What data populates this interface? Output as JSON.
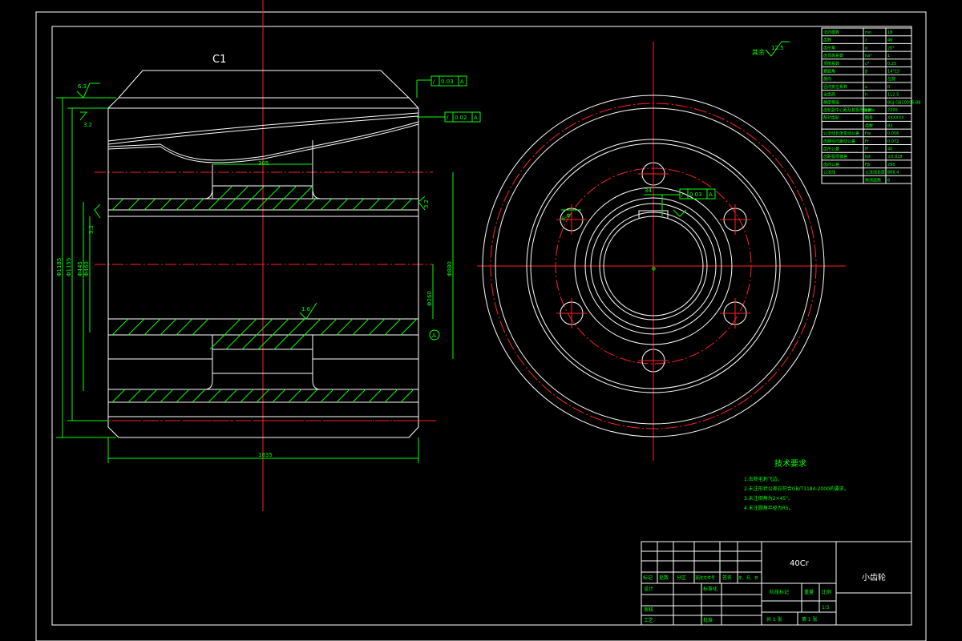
{
  "section_label": "C1",
  "roughness_top": "6.3",
  "roughness_left": "3.2",
  "roughness_left2": "3.2",
  "roughness_right": "3.2",
  "roughness_mid": "1.6",
  "roughness_general": "12.5",
  "roughness_general_note": "其余",
  "tolerance_runout_1": {
    "value": "0.03",
    "datum": "A"
  },
  "tolerance_runout_2": {
    "value": "0.02",
    "datum": "A"
  },
  "tolerance_runout_3": {
    "value": "0.03",
    "datum": "A"
  },
  "dim_inner_width": "305",
  "dim_total_length": "1835",
  "datum_label": "A",
  "dims_left": [
    "Φ1185",
    "Φ1155",
    "Φ445",
    "Φ460"
  ],
  "dim_right": "Φ880",
  "dim_right2": "Φ260",
  "tech_requirements": {
    "title": "技术要求",
    "items": [
      "1.去除毛刺飞边。",
      "2.未注形状公差应符合GB/T1184-2000的要求。",
      "3.未注倒角为2×45°。",
      "4.未注圆角半径为R5。"
    ]
  },
  "param_table": {
    "rows": [
      [
        "法向模数",
        "mn",
        "18"
      ],
      [
        "齿数",
        "z",
        "46"
      ],
      [
        "齿形角",
        "α",
        "20°"
      ],
      [
        "齿顶高系数",
        "ha*",
        "1"
      ],
      [
        "顶隙系数",
        "c*",
        "0.25"
      ],
      [
        "螺旋角",
        "β",
        "14°15'"
      ],
      [
        "旋向",
        "",
        "左旋"
      ],
      [
        "径向变位系数",
        "x",
        "0"
      ],
      [
        "全齿高",
        "h",
        "112.5"
      ],
      [
        "精度等级",
        "",
        "8GJ GB10095-88"
      ],
      [
        "齿轮副中心距及其极限偏差",
        "a±fa",
        "2200"
      ],
      [
        "配对齿轮",
        "图号",
        "XXXXXX"
      ],
      [
        "",
        "齿数",
        "83"
      ],
      [
        "公法线长度变动公差",
        "Fw",
        "0.056"
      ],
      [
        "齿圈径向跳动公差",
        "Fr",
        "0.072"
      ],
      [
        "齿形公差",
        "ff",
        "40"
      ],
      [
        "齿距极限偏差",
        "fpt",
        "±0.028"
      ],
      [
        "齿向公差",
        "Fβ",
        "290"
      ],
      [
        "公法线",
        "公法线长度",
        "888.4"
      ],
      [
        "",
        "跨测齿数",
        "6"
      ]
    ]
  },
  "title_block": {
    "material": "40Cr",
    "part_name": "小齿轮",
    "header_cells": [
      "标记",
      "处数",
      "分区",
      "更改文件号",
      "签名",
      "年、月、日"
    ],
    "design": "设计",
    "standardize": "标准化",
    "review": "审核",
    "process": "工艺",
    "approve": "批准",
    "stage_mark": "阶段标记",
    "weight": "重量",
    "scale_label": "比例",
    "scale_value": "1:5",
    "sheets_total": "共 1 张",
    "sheet_no": "第 1 张"
  }
}
